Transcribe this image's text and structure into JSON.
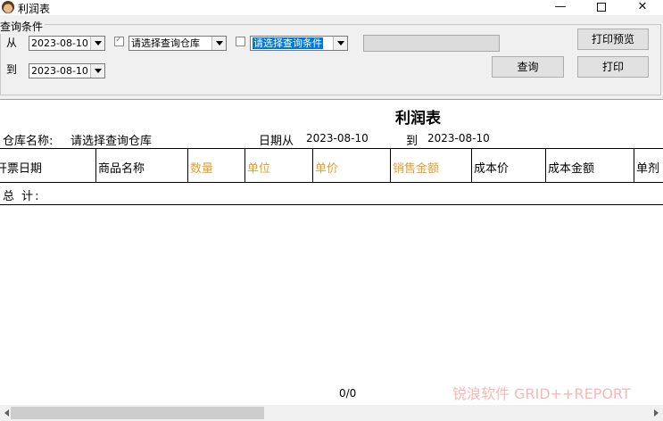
{
  "window": {
    "title": "利润表",
    "min_symbol": "—",
    "close_symbol": "✕"
  },
  "query": {
    "legend": "查询条件",
    "from_label": "从",
    "to_label": "到",
    "from_date": "2023-08-10",
    "to_date": "2023-08-10",
    "warehouse_checked": true,
    "warehouse_value": "请选择查询仓库",
    "condition_checked": false,
    "condition_value": "请选择查询条件",
    "print_preview_label": "打印预览",
    "query_label": "查询",
    "print_label": "打印"
  },
  "report": {
    "title": "利润表",
    "warehouse_label": "仓库名称:",
    "warehouse_value": "请选择查询仓库",
    "date_from_label": "日期从",
    "date_from": "2023-08-10",
    "date_to_label": "到",
    "date_to": "2023-08-10",
    "columns": [
      "开票日期",
      "商品名称",
      "数量",
      "单位",
      "单价",
      "销售金额",
      "成本价",
      "成本金额",
      "单剂"
    ],
    "total_label": "总  计:",
    "page_count": "0/0",
    "watermark": "锐浪软件 GRID++REPORT",
    "highlight_color": "#e0a030"
  }
}
